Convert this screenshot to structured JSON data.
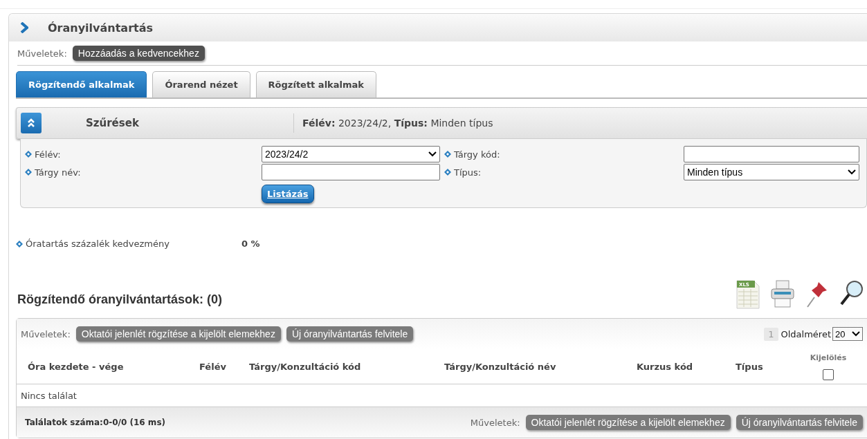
{
  "page": {
    "title": "Óranyilvántartás",
    "actions_label": "Műveletek:",
    "actions": [
      "Hozzáadás a kedvencekhez"
    ]
  },
  "tabs": [
    {
      "label": "Rögzítendő alkalmak",
      "selected": true
    },
    {
      "label": "Órarend nézet",
      "selected": false
    },
    {
      "label": "Rögzített alkalmak",
      "selected": false
    }
  ],
  "filter": {
    "title": "Szűrések",
    "expanded": true,
    "summary": "**Félév:** 2023/24/2, **Típus:** Minden típus",
    "fields": [
      {
        "label": "Félév:",
        "kind": "select",
        "value": "2023/24/2"
      },
      {
        "label": "Tárgy kód:",
        "kind": "text"
      },
      {
        "label": "Tárgy név:",
        "kind": "text"
      },
      {
        "label": "Típus:",
        "kind": "select",
        "value": "Minden típus"
      }
    ],
    "submit": "Listázás"
  },
  "discount": {
    "label": "Óratartás százalék kedvezmény",
    "value": "0 %"
  },
  "list": {
    "title": "Rögzítendő óranyilvántartások: (0)",
    "export_label": "XLS",
    "actions_label": "Műveletek:",
    "actions": [
      "Oktatói jelenlét rögzítése a kijelölt elemekhez",
      "Új óranyilvántartás felvitele"
    ],
    "page": "1",
    "page_size_label": "Oldalméret",
    "page_size": "20",
    "columns": [
      "Óra kezdete - vége",
      "Félév",
      "Tárgy/Konzultáció kód",
      "Tárgy/Konzultáció név",
      "Kurzus kód",
      "Típus"
    ],
    "select_column": {
      "label": "Kijelölés",
      "checked": false
    },
    "empty_text": "Nincs találat",
    "footer": "Találatok száma:0-0/0 (16 ms)",
    "footer_actions_label": "Műveletek:",
    "footer_actions": [
      "Oktatói jelenlét rögzítése a kijelölt elemekhez",
      "Új óranyilvántartás felvitele"
    ]
  }
}
